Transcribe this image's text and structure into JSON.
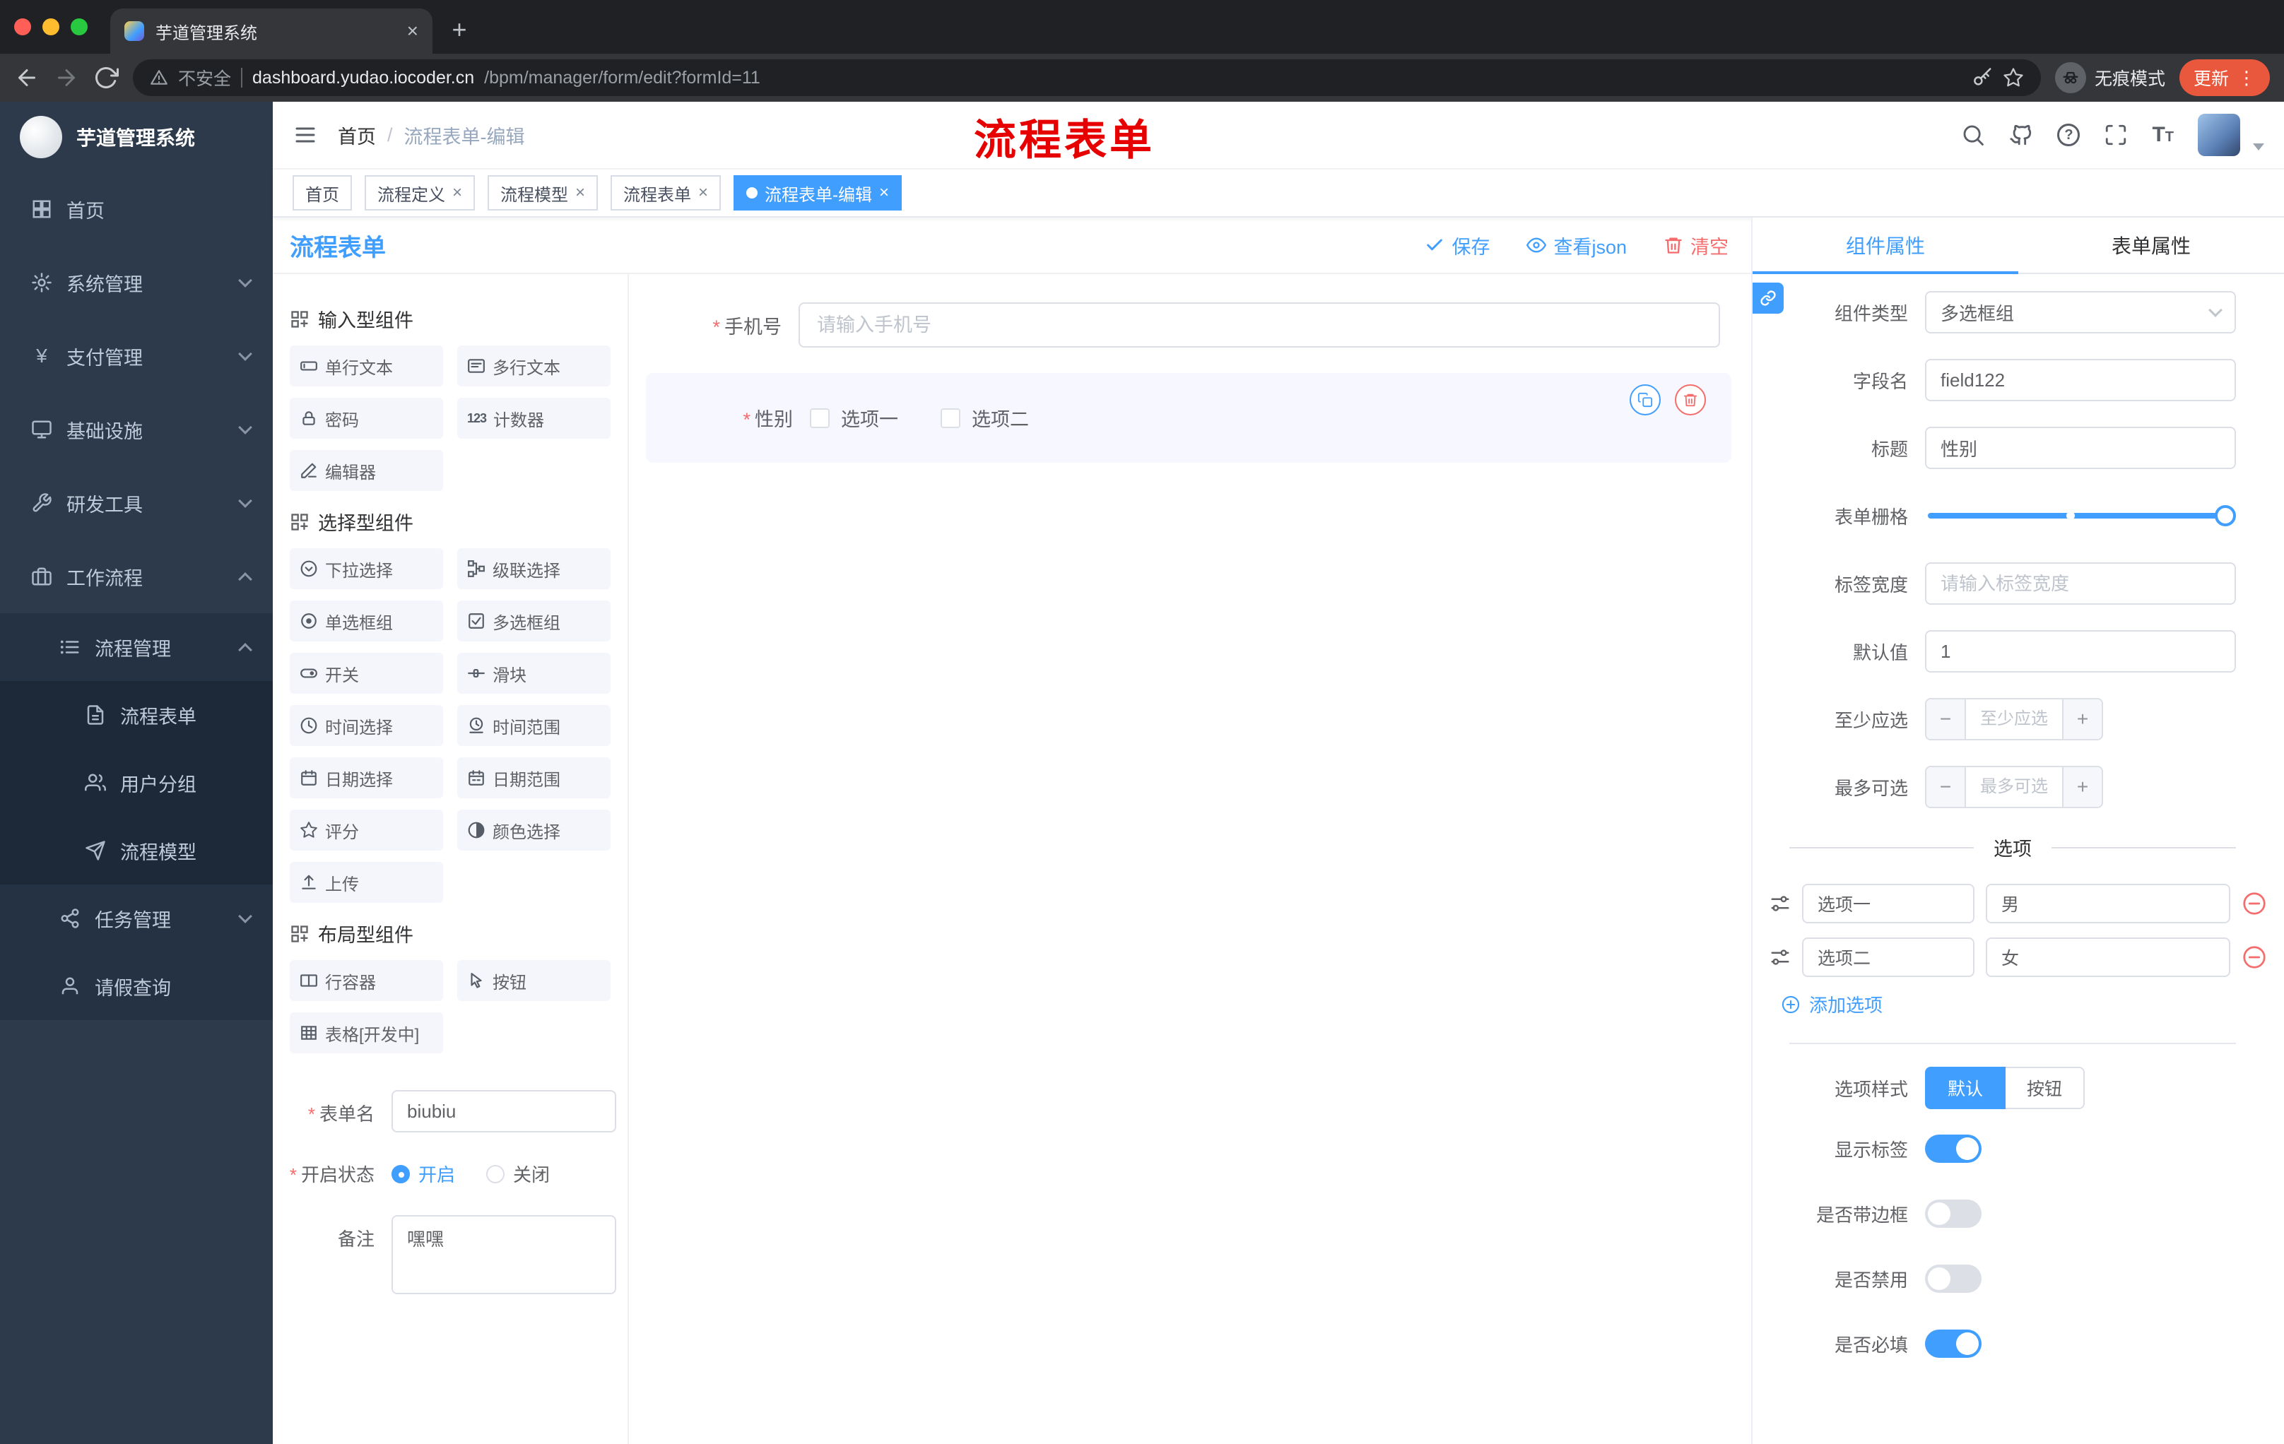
{
  "browser": {
    "tab_title": "芋道管理系统",
    "security": "不安全",
    "url_domain": "dashboard.yudao.iocoder.cn",
    "url_path": "/bpm/manager/form/edit?formId=11",
    "incognito": "无痕模式",
    "update": "更新"
  },
  "glyphs": {
    "close": "×",
    "plus": "+",
    "kebab": "⋮",
    "slash": "/",
    "help": "?",
    "font_size_big": "T",
    "font_size_small": "T",
    "counter": "123",
    "minus": "−"
  },
  "sidebar": {
    "title": "芋道管理系统",
    "items": [
      {
        "label": "首页"
      },
      {
        "label": "系统管理"
      },
      {
        "label": "支付管理"
      },
      {
        "label": "基础设施"
      },
      {
        "label": "研发工具"
      },
      {
        "label": "工作流程"
      },
      {
        "label": "流程管理"
      },
      {
        "label": "流程表单"
      },
      {
        "label": "用户分组"
      },
      {
        "label": "流程模型"
      },
      {
        "label": "任务管理"
      },
      {
        "label": "请假查询"
      }
    ]
  },
  "header": {
    "breadcrumb_home": "首页",
    "breadcrumb_current": "流程表单-编辑",
    "annotation": "流程表单"
  },
  "tags": [
    {
      "label": "首页"
    },
    {
      "label": "流程定义"
    },
    {
      "label": "流程模型"
    },
    {
      "label": "流程表单"
    },
    {
      "label": "流程表单-编辑"
    }
  ],
  "toolbar": {
    "title": "流程表单",
    "save": "保存",
    "view_json": "查看json",
    "clear": "清空"
  },
  "palette": {
    "sections": [
      {
        "title": "输入型组件",
        "items": [
          {
            "label": "单行文本"
          },
          {
            "label": "多行文本"
          },
          {
            "label": "密码"
          },
          {
            "label": "计数器"
          },
          {
            "label": "编辑器"
          }
        ]
      },
      {
        "title": "选择型组件",
        "items": [
          {
            "label": "下拉选择"
          },
          {
            "label": "级联选择"
          },
          {
            "label": "单选框组"
          },
          {
            "label": "多选框组"
          },
          {
            "label": "开关"
          },
          {
            "label": "滑块"
          },
          {
            "label": "时间选择"
          },
          {
            "label": "时间范围"
          },
          {
            "label": "日期选择"
          },
          {
            "label": "日期范围"
          },
          {
            "label": "评分"
          },
          {
            "label": "颜色选择"
          },
          {
            "label": "上传"
          }
        ]
      },
      {
        "title": "布局型组件",
        "items": [
          {
            "label": "行容器"
          },
          {
            "label": "按钮"
          },
          {
            "label": "表格[开发中]"
          }
        ]
      }
    ],
    "form": {
      "name_label": "表单名",
      "name_value": "biubiu",
      "status_label": "开启状态",
      "status_on": "开启",
      "status_off": "关闭",
      "remark_label": "备注",
      "remark_value": "嘿嘿"
    }
  },
  "canvas": {
    "phone_label": "手机号",
    "phone_placeholder": "请输入手机号",
    "gender_label": "性别",
    "gender_option1": "选项一",
    "gender_option2": "选项二"
  },
  "props": {
    "tab_component": "组件属性",
    "tab_form": "表单属性",
    "component_type_label": "组件类型",
    "component_type_value": "多选框组",
    "field_name_label": "字段名",
    "field_name_value": "field122",
    "title_label": "标题",
    "title_value": "性别",
    "grid_label": "表单栅格",
    "label_width_label": "标签宽度",
    "label_width_placeholder": "请输入标签宽度",
    "default_label": "默认值",
    "default_value": "1",
    "min_label": "至少应选",
    "min_placeholder": "至少应选",
    "max_label": "最多可选",
    "max_placeholder": "最多可选",
    "options_divider": "选项",
    "options": [
      {
        "label": "选项一",
        "value": "男"
      },
      {
        "label": "选项二",
        "value": "女"
      }
    ],
    "add_option": "添加选项",
    "style_label": "选项样式",
    "style_default": "默认",
    "style_button": "按钮",
    "show_label_label": "显示标签",
    "border_label": "是否带边框",
    "disabled_label": "是否禁用",
    "required_label": "是否必填"
  },
  "colors": {
    "accent": "#409eff",
    "danger": "#f56c6c",
    "annotation": "#e60000",
    "sidebar_bg": "#2d3a4b",
    "update_badge": "#e9573d"
  }
}
